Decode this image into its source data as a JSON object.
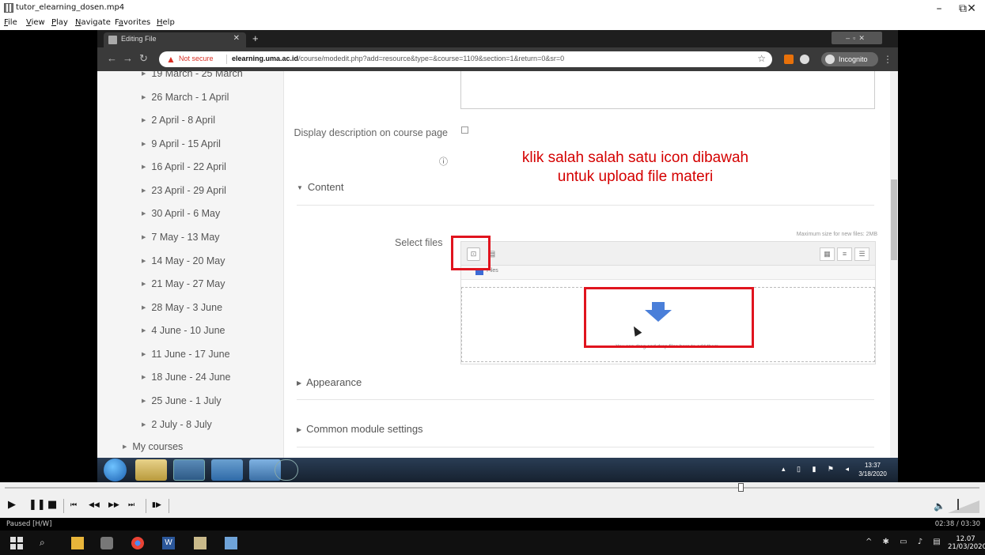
{
  "player": {
    "title": "tutor_elearning_dosen.mp4",
    "menu": [
      {
        "label": "File",
        "u": "F",
        "rest": "ile"
      },
      {
        "label": "View",
        "u": "V",
        "rest": "iew"
      },
      {
        "label": "Play",
        "u": "P",
        "rest": "lay"
      },
      {
        "label": "Navigate",
        "u": "N",
        "rest": "avigate"
      },
      {
        "label": "Favorites",
        "u": "a",
        "pre": "F",
        "rest": "vorites"
      },
      {
        "label": "Help",
        "u": "H",
        "rest": "elp"
      }
    ],
    "status": "Paused [H/W]",
    "time": "02:38 / 03:30",
    "window_controls": {
      "minimize": "–",
      "maximize": "⧉",
      "close": "✕"
    }
  },
  "browser": {
    "tab_title": "Editing File",
    "not_secure": "Not secure",
    "url_domain": "elearning.uma.ac.id",
    "url_path": "/course/modedit.php?add=resource&type=&course=1109&section=1&return=0&sr=0",
    "incognito": "Incognito"
  },
  "sidebar": {
    "items": [
      "19 March - 25 March",
      "26 March - 1 April",
      "2 April - 8 April",
      "9 April - 15 April",
      "16 April - 22 April",
      "23 April - 29 April",
      "30 April - 6 May",
      "7 May - 13 May",
      "14 May - 20 May",
      "21 May - 27 May",
      "28 May - 3 June",
      "4 June - 10 June",
      "11 June - 17 June",
      "18 June - 24 June",
      "25 June - 1 July",
      "2 July - 8 July"
    ],
    "my_courses": "My courses"
  },
  "form": {
    "display_description_label": "Display description on course page",
    "content_section": "Content",
    "select_files_label": "Select files",
    "max_size": "Maximum size for new files: 2MB",
    "files_folder": "Files",
    "drop_text": "You can drag and drop files here to add them.",
    "appearance_section": "Appearance",
    "common_module_section": "Common module settings"
  },
  "annotation": {
    "line1": "klik salah salah satu icon dibawah",
    "line2": "untuk upload file materi",
    "color": "#d40000"
  },
  "recorded_taskbar": {
    "time": "13:37",
    "date": "3/18/2020"
  },
  "host_taskbar": {
    "time": "12.07",
    "date": "21/03/2020"
  }
}
